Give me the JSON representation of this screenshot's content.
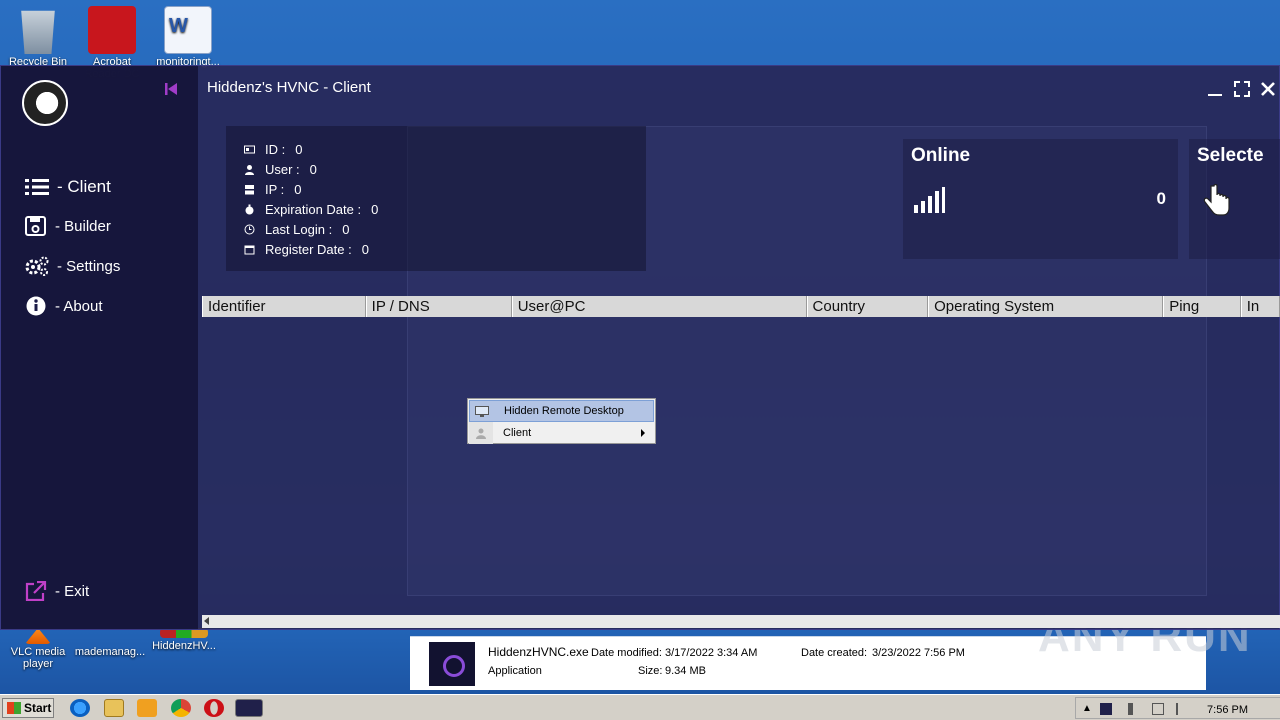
{
  "desktop": {
    "icons": [
      {
        "label": "Recycle Bin",
        "icon": "recycle-bin-icon"
      },
      {
        "label": "Acrobat Reader DC",
        "icon": "acrobat-icon"
      },
      {
        "label": "monitoringt...",
        "icon": "word-document-icon"
      },
      {
        "label": "VLC media player",
        "icon": "vlc-icon"
      },
      {
        "label": "mademanag...",
        "icon": "document-icon"
      },
      {
        "label": "HiddenzHV...",
        "icon": "winrar-icon"
      }
    ]
  },
  "window": {
    "title": "Hiddenz's HVNC - Client"
  },
  "sidebar": {
    "items": [
      {
        "label": "- Client",
        "icon": "list-icon"
      },
      {
        "label": "- Builder",
        "icon": "save-icon"
      },
      {
        "label": "- Settings",
        "icon": "gears-icon"
      },
      {
        "label": "- About",
        "icon": "info-icon"
      },
      {
        "label": "- Exit",
        "icon": "exit-icon"
      }
    ]
  },
  "info": {
    "rows": [
      {
        "label": "ID :",
        "value": "0"
      },
      {
        "label": "User :",
        "value": "0"
      },
      {
        "label": "IP :",
        "value": "0"
      },
      {
        "label": "Expiration Date :",
        "value": "0"
      },
      {
        "label": "Last Login :",
        "value": "0"
      },
      {
        "label": "Register Date :",
        "value": "0"
      }
    ]
  },
  "stats": {
    "online": {
      "title": "Online",
      "count": "0"
    },
    "selected": {
      "title": "Selecte"
    }
  },
  "table": {
    "columns": [
      "Identifier",
      "IP / DNS",
      "User@PC",
      "Country",
      "Operating System",
      "Ping",
      "In"
    ]
  },
  "context_menu": {
    "items": [
      {
        "label": "Hidden Remote Desktop"
      },
      {
        "label": "Client"
      }
    ]
  },
  "details": {
    "filename": "HiddenzHVNC.exe",
    "modified_label": "Date modified:",
    "modified": "3/17/2022 3:34 AM",
    "created_label": "Date created:",
    "created": "3/23/2022 7:56 PM",
    "type": "Application",
    "size_label": "Size:",
    "size": "9.34 MB"
  },
  "watermark": "ANY RUN",
  "taskbar": {
    "start_label": "Start",
    "clock": "7:56 PM"
  }
}
